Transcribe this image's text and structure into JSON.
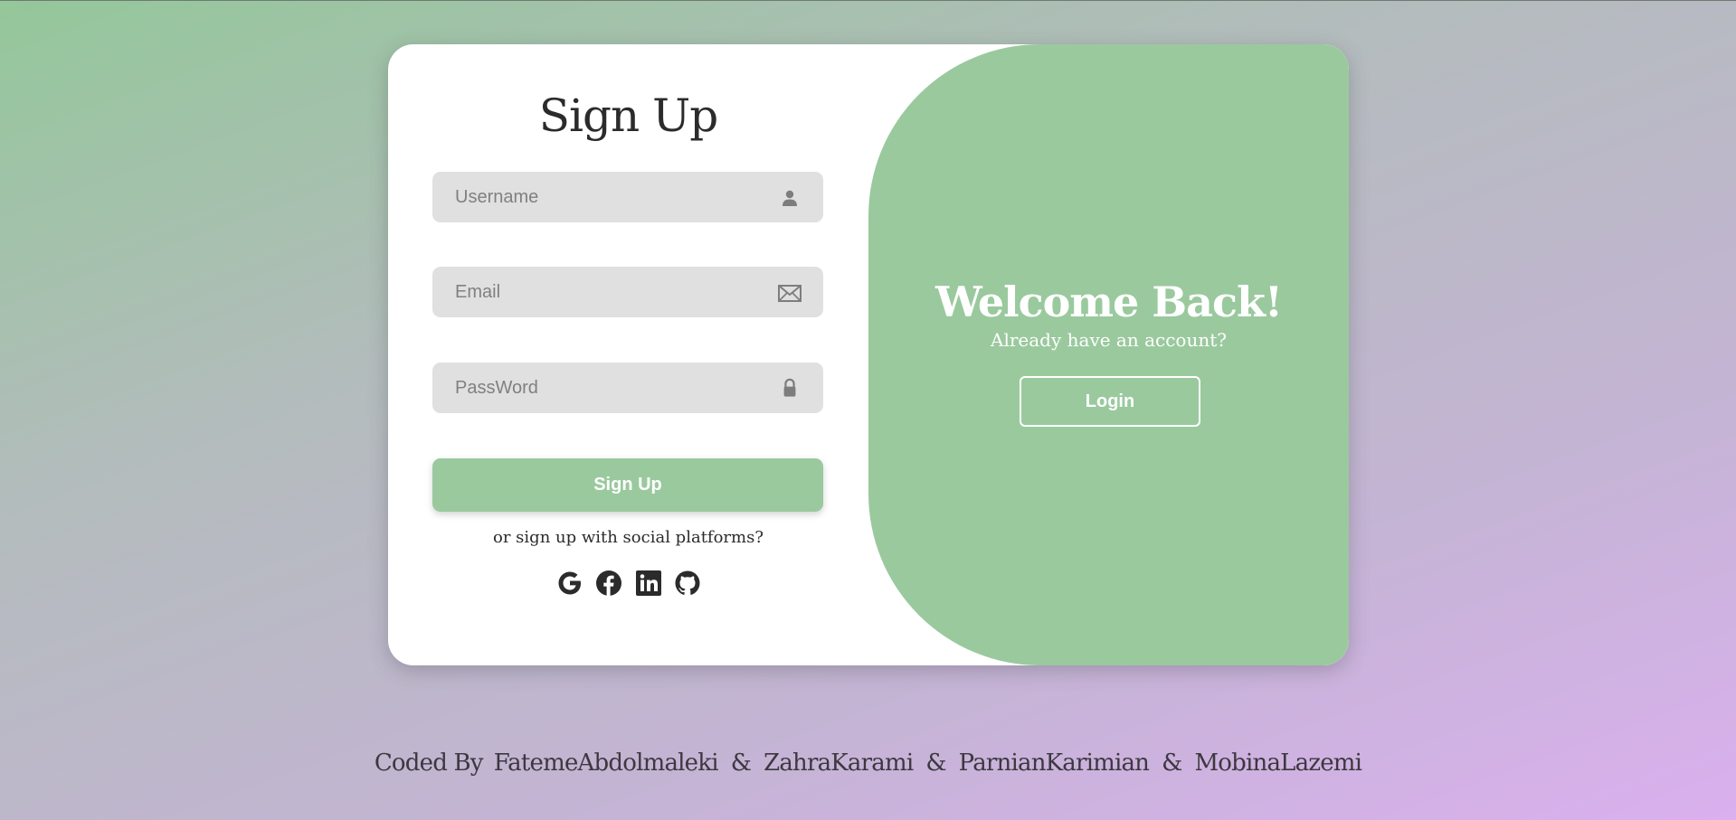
{
  "form": {
    "title": "Sign Up",
    "username_placeholder": "Username",
    "email_placeholder": "Email",
    "password_placeholder": "PassWord",
    "submit_label": "Sign Up",
    "social_text": "or sign up with social platforms?",
    "social_icons": [
      "google-icon",
      "facebook-icon",
      "linkedin-icon",
      "github-icon"
    ]
  },
  "panel": {
    "heading": "Welcome Back!",
    "subheading": "Already have an account?",
    "login_label": "Login"
  },
  "footer": {
    "prefix": "Coded By",
    "separator": "&",
    "authors": [
      "FatemeAbdolmaleki",
      "ZahraKarami",
      "ParnianKarimian",
      "MobinaLazemi"
    ]
  },
  "colors": {
    "accent_green": "#9ac99e",
    "field_bg": "#e0e0e0",
    "text_dark": "#2b2b2b"
  }
}
